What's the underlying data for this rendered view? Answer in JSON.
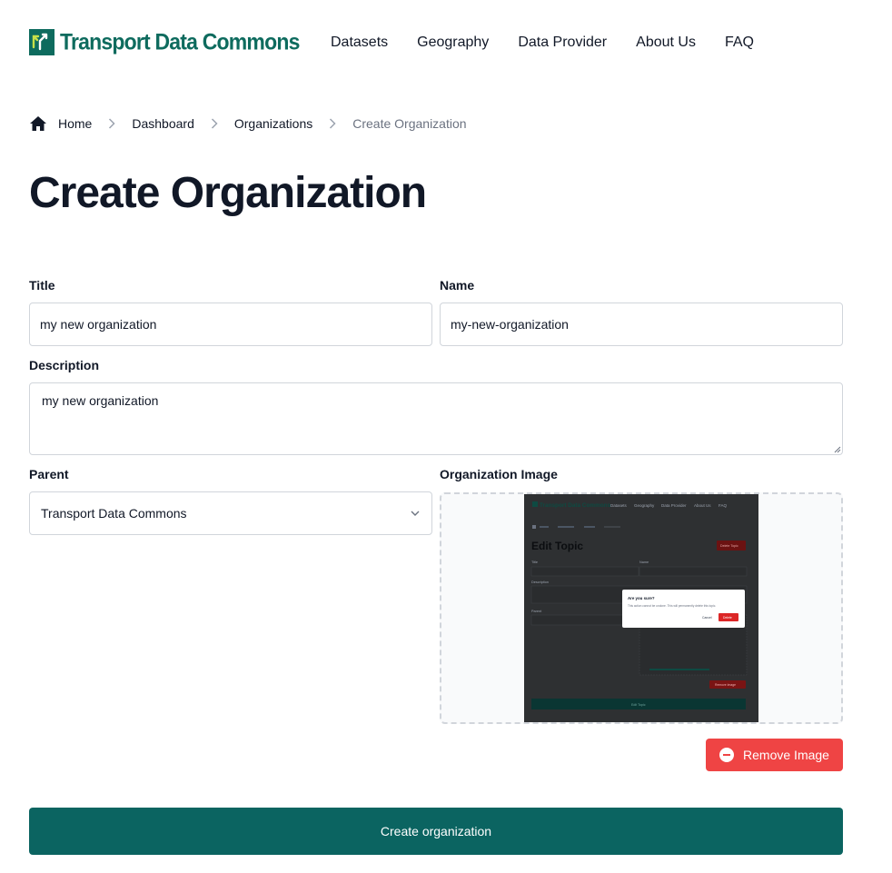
{
  "brand": {
    "name": "Transport Data Commons",
    "color": "#0e6b5e"
  },
  "nav": [
    {
      "label": "Datasets"
    },
    {
      "label": "Geography"
    },
    {
      "label": "Data Provider"
    },
    {
      "label": "About Us"
    },
    {
      "label": "FAQ"
    }
  ],
  "breadcrumb": {
    "home": "Home",
    "dashboard": "Dashboard",
    "organizations": "Organizations",
    "current": "Create Organization"
  },
  "page_title": "Create Organization",
  "form": {
    "title_label": "Title",
    "title_value": "my new organization",
    "name_label": "Name",
    "name_value": "my-new-organization",
    "description_label": "Description",
    "description_value": "my new organization",
    "parent_label": "Parent",
    "parent_value": "Transport Data Commons",
    "image_label": "Organization Image",
    "remove_image_label": "Remove Image",
    "submit_label": "Create organization"
  },
  "image_preview": {
    "brand": "Transport Data Commons",
    "nav": [
      "Datasets",
      "Geography",
      "Data Provider",
      "About Us",
      "FAQ"
    ],
    "title": "Edit Topic",
    "delete_label": "Delete Topic",
    "modal_title": "Are you sure?",
    "modal_text": "This action cannot be undone. This will permanently delete this topic.",
    "cancel_label": "Cancel",
    "confirm_label": "Delete",
    "field_title_label": "Title",
    "field_name_label": "Name",
    "field_desc_label": "Description",
    "field_parent_label": "Parent",
    "remove_label": "Remove Image",
    "save_label": "Edit Topic"
  },
  "colors": {
    "primary": "#0b6461",
    "danger": "#ef4444",
    "text": "#111827",
    "muted": "#6b7280"
  }
}
